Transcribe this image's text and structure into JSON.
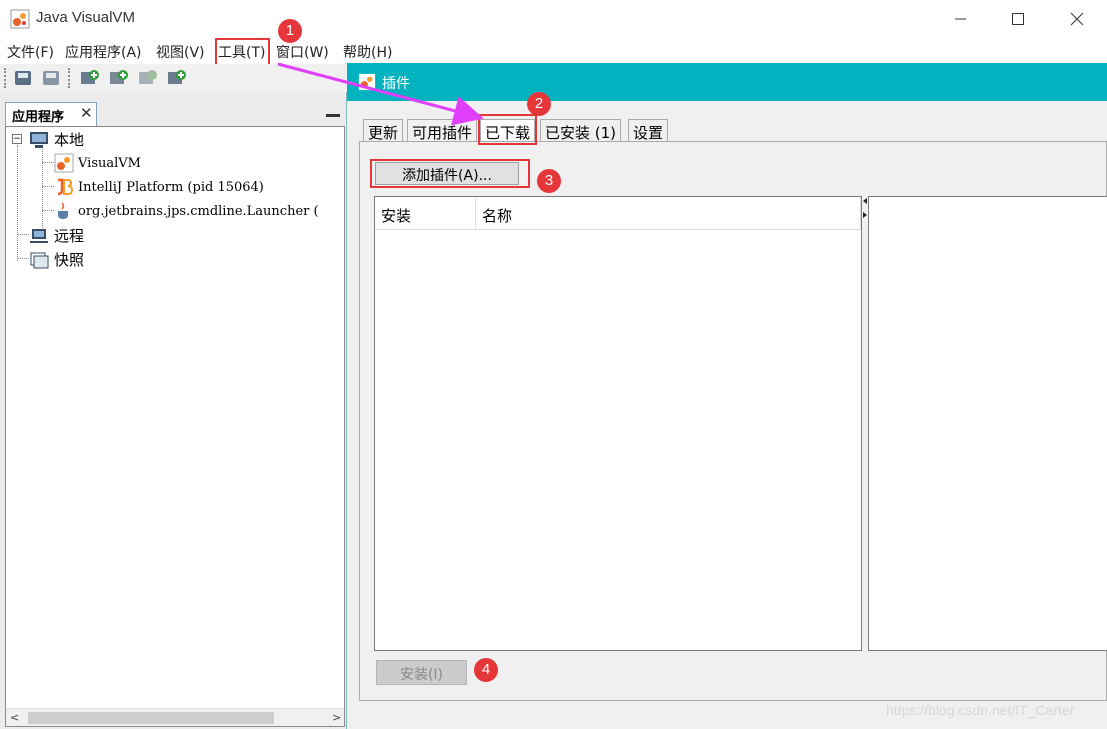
{
  "window": {
    "title": "Java VisualVM",
    "controls": [
      "minimize",
      "maximize",
      "close"
    ]
  },
  "menu": {
    "items": [
      "文件(F)",
      "应用程序(A)",
      "视图(V)",
      "工具(T)",
      "窗口(W)",
      "帮助(H)"
    ],
    "highlighted_item": "工具(T)"
  },
  "toolbar": {
    "buttons": [
      "open-icon",
      "save-icon",
      "add-jmx-icon",
      "add-heap-dump-icon",
      "snapshot-icon",
      "compare-icon"
    ]
  },
  "left_panel": {
    "tab_label": "应用程序",
    "tree": {
      "local": "本地",
      "local_children": [
        "VisualVM",
        "IntelliJ Platform (pid 15064)",
        "org.jetbrains.jps.cmdline.Launcher ("
      ],
      "remote": "远程",
      "snapshots": "快照"
    }
  },
  "dialog": {
    "title": "插件",
    "tabs": [
      "更新",
      "可用插件",
      "已下载",
      "已安装 (1)",
      "设置"
    ],
    "active_tab": "已下载",
    "add_plugin_button": "添加插件(A)...",
    "table_headers": [
      "安装",
      "名称"
    ],
    "install_button": "安装(I)"
  },
  "annotations": {
    "badges": [
      "1",
      "2",
      "3",
      "4"
    ],
    "highlight_color": "#e5373a",
    "arrow_color": "#e040fb"
  },
  "watermark": "https://blog.csdn.net/IT_Carter",
  "colors": {
    "dialog_titlebar": "#00b3bf"
  }
}
